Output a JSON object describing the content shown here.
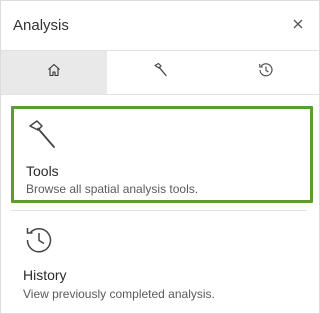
{
  "header": {
    "title": "Analysis",
    "close_icon": "close-icon"
  },
  "tabs": [
    {
      "name": "home",
      "icon": "home-icon",
      "active": true
    },
    {
      "name": "tools",
      "icon": "hammer-icon",
      "active": false
    },
    {
      "name": "history",
      "icon": "history-icon",
      "active": false
    }
  ],
  "cards": {
    "tools": {
      "title": "Tools",
      "description": "Browse all spatial analysis tools.",
      "icon": "hammer-icon",
      "selected": true
    },
    "history": {
      "title": "History",
      "description": "View previously completed analysis.",
      "icon": "history-icon"
    }
  },
  "colors": {
    "selection_border": "#5a9e2f",
    "active_tab_bg": "#e9e9e9",
    "text": "#2b2b2b"
  }
}
